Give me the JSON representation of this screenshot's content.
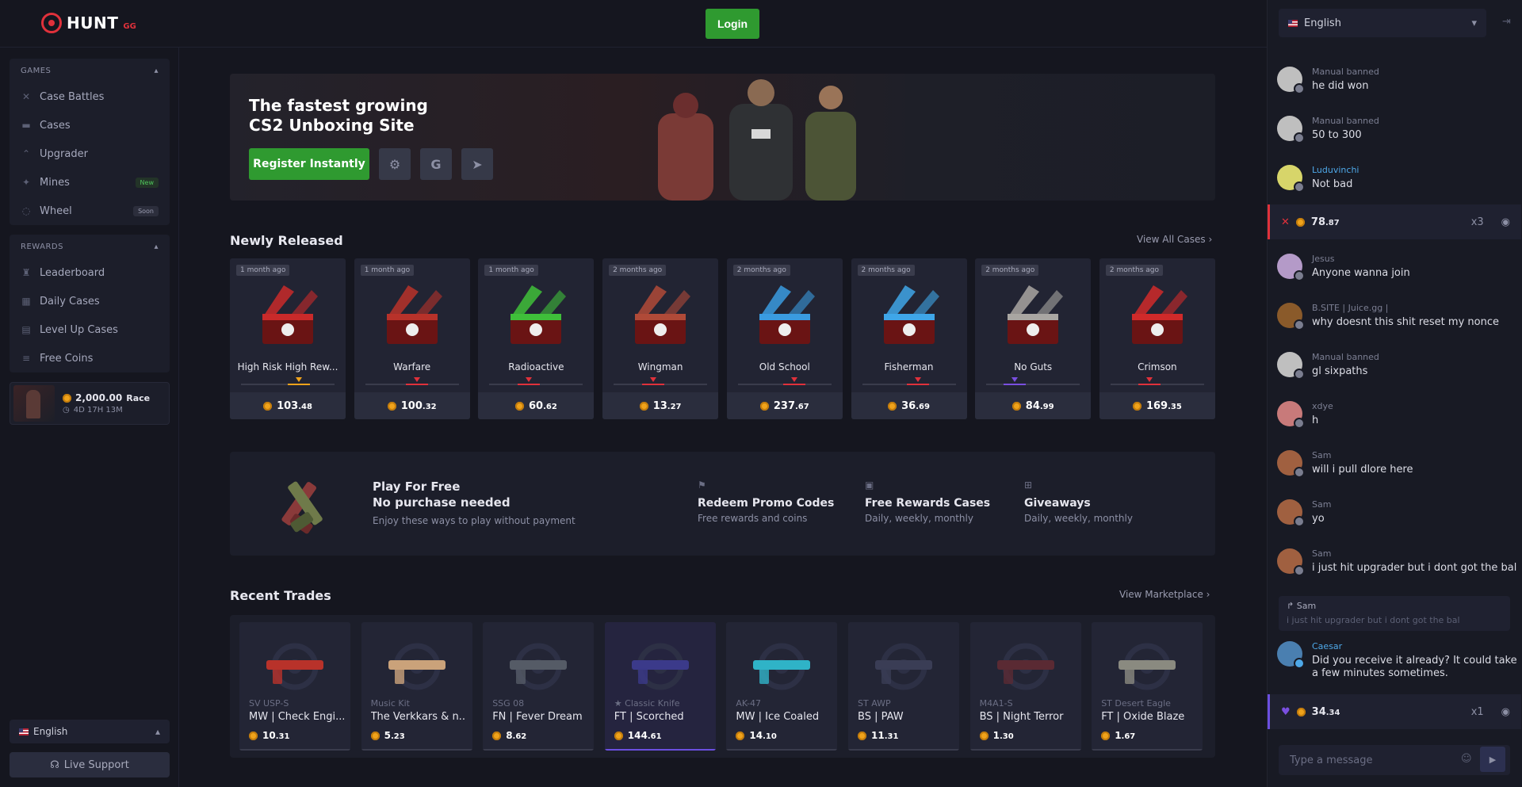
{
  "brand": {
    "name": "HUNT",
    "suffix": "GG"
  },
  "header": {
    "login": "Login"
  },
  "sidebar": {
    "games_title": "GAMES",
    "games": [
      {
        "label": "Case Battles",
        "icon": "swords-icon"
      },
      {
        "label": "Cases",
        "icon": "box-icon"
      },
      {
        "label": "Upgrader",
        "icon": "upgrade-icon"
      },
      {
        "label": "Mines",
        "icon": "mine-icon",
        "badge": "New"
      },
      {
        "label": "Wheel",
        "icon": "wheel-icon",
        "badge": "Soon"
      }
    ],
    "rewards_title": "REWARDS",
    "rewards": [
      {
        "label": "Leaderboard",
        "icon": "trophy-icon"
      },
      {
        "label": "Daily Cases",
        "icon": "calendar-icon"
      },
      {
        "label": "Level Up Cases",
        "icon": "levelup-icon"
      },
      {
        "label": "Free Coins",
        "icon": "coins-icon"
      }
    ],
    "race": {
      "amount": "2,000.00",
      "label": "Race",
      "timer": "4D 17H 13M"
    },
    "language": "English",
    "support": "Live Support"
  },
  "hero": {
    "title_line1": "The fastest growing",
    "title_line2": "CS2 Unboxing Site",
    "register": "Register Instantly"
  },
  "newly": {
    "title": "Newly Released",
    "view_all": "View All Cases",
    "cases": [
      {
        "age": "1 month ago",
        "name": "High Risk High Rew...",
        "price_int": "103",
        "price_dec": ".48",
        "color": "#c92a2a",
        "tick": "#f0a31b",
        "pos": 0.62
      },
      {
        "age": "1 month ago",
        "name": "Warfare",
        "price_int": "100",
        "price_dec": ".32",
        "color": "#b8322a",
        "tick": "#e0313b",
        "pos": 0.55
      },
      {
        "age": "1 month ago",
        "name": "Radioactive",
        "price_int": "60",
        "price_dec": ".62",
        "color": "#3fbf3a",
        "tick": "#e0313b",
        "pos": 0.42
      },
      {
        "age": "2 months ago",
        "name": "Wingman",
        "price_int": "13",
        "price_dec": ".27",
        "color": "#b04a38",
        "tick": "#e0313b",
        "pos": 0.42
      },
      {
        "age": "2 months ago",
        "name": "Old School",
        "price_int": "237",
        "price_dec": ".67",
        "color": "#3a9be0",
        "tick": "#e0313b",
        "pos": 0.6
      },
      {
        "age": "2 months ago",
        "name": "Fisherman",
        "price_int": "36",
        "price_dec": ".69",
        "color": "#3fa6e8",
        "tick": "#e0313b",
        "pos": 0.6
      },
      {
        "age": "2 months ago",
        "name": "No Guts",
        "price_int": "84",
        "price_dec": ".99",
        "color": "#a9a6a2",
        "tick": "#7a4fe0",
        "pos": 0.3
      },
      {
        "age": "2 months ago",
        "name": "Crimson",
        "price_int": "169",
        "price_dec": ".35",
        "color": "#d02a2a",
        "tick": "#e0313b",
        "pos": 0.42
      }
    ]
  },
  "promo": {
    "title1": "Play For Free",
    "title2": "No purchase needed",
    "subtitle": "Enjoy these ways to play without payment",
    "items": [
      {
        "title": "Redeem Promo Codes",
        "sub": "Free rewards and coins",
        "icon": "flag-icon"
      },
      {
        "title": "Free Rewards Cases",
        "sub": "Daily, weekly, monthly",
        "icon": "cases-icon"
      },
      {
        "title": "Giveaways",
        "sub": "Daily, weekly, monthly",
        "icon": "gift-icon"
      }
    ]
  },
  "trades": {
    "title": "Recent Trades",
    "view": "View Marketplace",
    "items": [
      {
        "sub": "SV USP-S",
        "name": "MW | Check Engi...",
        "price_int": "10",
        "price_dec": ".31",
        "color": "#b8322a"
      },
      {
        "sub": "Music Kit",
        "name": "The Verkkars & n...",
        "price_int": "5",
        "price_dec": ".23",
        "color": "#caa27a"
      },
      {
        "sub": "SSG 08",
        "name": "FN | Fever Dream",
        "price_int": "8",
        "price_dec": ".62",
        "color": "#555b66"
      },
      {
        "sub": "★ Classic Knife",
        "name": "FT | Scorched",
        "price_int": "144",
        "price_dec": ".61",
        "color": "#3b3a8a",
        "highlight": true
      },
      {
        "sub": "AK-47",
        "name": "MW | Ice Coaled",
        "price_int": "14",
        "price_dec": ".10",
        "color": "#2fb3c7"
      },
      {
        "sub": "ST AWP",
        "name": "BS | PAW",
        "price_int": "11",
        "price_dec": ".31",
        "color": "#3a3d55"
      },
      {
        "sub": "M4A1-S",
        "name": "BS | Night Terror",
        "price_int": "1",
        "price_dec": ".30",
        "color": "#5a2a33"
      },
      {
        "sub": "ST Desert Eagle",
        "name": "FT | Oxide Blaze",
        "price_int": "1",
        "price_dec": ".67",
        "color": "#8a8a80"
      }
    ]
  },
  "chat": {
    "language": "English",
    "placeholder": "Type a message",
    "messages": [
      {
        "user": "Manual banned",
        "text": "he did won",
        "ucolor": "#7c7f93",
        "acolor": "#bfbfbf"
      },
      {
        "user": "Manual banned",
        "text": "50 to 300",
        "ucolor": "#7c7f93",
        "acolor": "#bfbfbf"
      },
      {
        "user": "Luduvinchi",
        "text": "Not bad",
        "ucolor": "#4ea8e8",
        "acolor": "#d7d56a"
      },
      {
        "user": "Jesus",
        "text": "Anyone wanna join",
        "ucolor": "#7c7f93",
        "acolor": "#b49ac8"
      },
      {
        "user": "B.SITE | Juice.gg |",
        "text": "why doesnt this shit reset my nonce",
        "ucolor": "#7c7f93",
        "acolor": "#8a5a2a"
      },
      {
        "user": "Manual banned",
        "text": "gl sixpaths",
        "ucolor": "#7c7f93",
        "acolor": "#bfbfbf"
      },
      {
        "user": "xdye",
        "text": "h",
        "ucolor": "#7c7f93",
        "acolor": "#c87a7a"
      },
      {
        "user": "Sam",
        "text": "will i pull dlore here",
        "ucolor": "#7c7f93",
        "acolor": "#a06040"
      },
      {
        "user": "Sam",
        "text": "yo",
        "ucolor": "#7c7f93",
        "acolor": "#a06040"
      },
      {
        "user": "Sam",
        "text": "i just hit upgrader but i dont got the bal",
        "ucolor": "#7c7f93",
        "acolor": "#a06040"
      }
    ],
    "reply": {
      "user": "Sam",
      "text": "i just hit upgrader but i dont got the bal"
    },
    "last": {
      "user": "Caesar",
      "text": "Did you receive it already? It could take a few minutes sometimes.",
      "ucolor": "#4ea8e8",
      "acolor": "#4a7fb0"
    },
    "bet1": {
      "int": "78",
      "dec": ".87",
      "mult": "x3"
    },
    "bet2": {
      "int": "34",
      "dec": ".34",
      "mult": "x1"
    }
  }
}
